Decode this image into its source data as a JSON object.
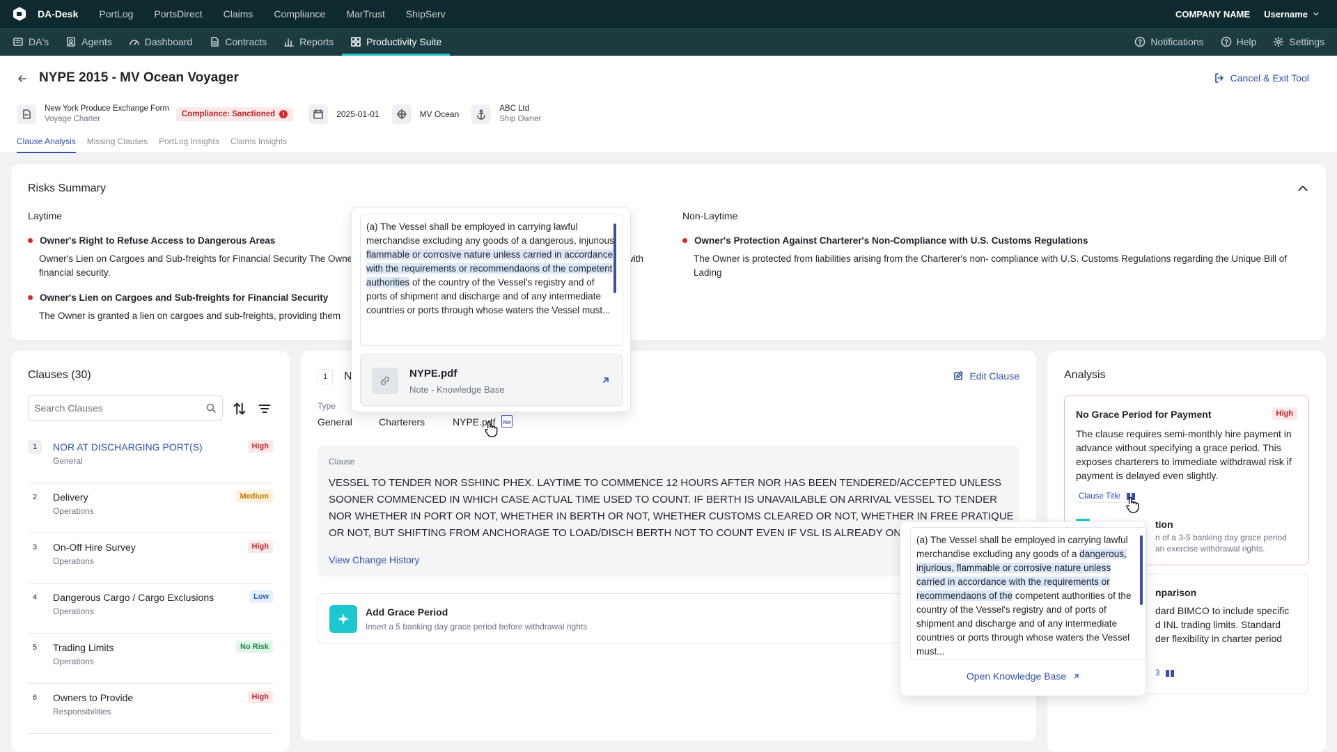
{
  "topnav": {
    "brand": "DA-Desk",
    "links": [
      "PortLog",
      "PortsDirect",
      "Claims",
      "Compliance",
      "MarTrust",
      "ShipServ"
    ],
    "company": "COMPANY NAME",
    "username": "Username"
  },
  "subnav": {
    "items": [
      "DA's",
      "Agents",
      "Dashboard",
      "Contracts",
      "Reports",
      "Productivity Suite"
    ],
    "right": [
      "Notifications",
      "Help",
      "Settings"
    ]
  },
  "header": {
    "title": "NYPE 2015 - MV Ocean Voyager",
    "cancel": "Cancel & Exit Tool",
    "form_name": "New York Produce Exchange Form",
    "form_type": "Voyage Charter",
    "compliance": "Compliance: Sanctioned",
    "compliance_count": "!",
    "date": "2025-01-01",
    "vessel": "MV Ocean",
    "owner_name": "ABC Ltd",
    "owner_role": "Ship Owner"
  },
  "tabs": [
    "Clause Analysis",
    "Missing Clauses",
    "PortLog Insights",
    "Claims Insights"
  ],
  "risks": {
    "title": "Risks Summary",
    "laytime_label": "Laytime",
    "nonlaytime_label": "Non-Laytime",
    "laytime": [
      {
        "title": "Owner's Right to Refuse Access to Dangerous Areas",
        "desc": "Owner's Lien on Cargoes and Sub-freights for Financial Security The Owner",
        "desc_tail": "with",
        "desc2": "financial security."
      },
      {
        "title": "Owner's Lien on Cargoes and Sub-freights for Financial Security",
        "desc": "The Owner is granted a lien on cargoes and sub-freights, providing them"
      }
    ],
    "nonlaytime": [
      {
        "title": "Owner's Protection Against Charterer's Non-Compliance with U.S. Customs Regulations",
        "desc": "The Owner is protected from liabilities arising from the Charterer's non- compliance with U.S. Customs Regulations regarding the Unique Bill of",
        "desc2": "Lading"
      }
    ]
  },
  "clauses": {
    "title": "Clauses (30)",
    "search_placeholder": "Search Clauses",
    "items": [
      {
        "num": "1",
        "title": "NOR AT DISCHARGING PORT(S)",
        "cat": "General",
        "level": "High"
      },
      {
        "num": "2",
        "title": "Delivery",
        "cat": "Operations",
        "level": "Medium"
      },
      {
        "num": "3",
        "title": "On-Off Hire Survey",
        "cat": "Operations",
        "level": "High"
      },
      {
        "num": "4",
        "title": "Dangerous Cargo / Cargo Exclusions",
        "cat": "Operations",
        "level": "Low"
      },
      {
        "num": "5",
        "title": "Trading Limits",
        "cat": "Operations",
        "level": "No Risk"
      },
      {
        "num": "6",
        "title": "Owners to Provide",
        "cat": "Responsibilities",
        "level": "High"
      }
    ]
  },
  "detail": {
    "num": "1",
    "title_partial": "N",
    "edit": "Edit Clause",
    "type_label": "Type",
    "type_value": "General",
    "party": "Charterers",
    "file": "NYPE.pdf",
    "file_icon_label": "PDF",
    "clause_label": "Clause",
    "clause_lines": [
      "VESSEL TO TENDER NOR SSHINC PHEX. LAYTIME TO COMMENCE 12 HOURS AFTER NOR HAS BEEN TENDERED/ACCEPTED UNLESS",
      "SOONER COMMENCED IN WHICH CASE ACTUAL TIME USED TO COUNT. IF BERTH IS UNAVAILABLE ON ARRIVAL VESSEL TO TENDER",
      "NOR WHETHER IN PORT OR NOT, WHETHER IN BERTH OR NOT, WHETHER CUSTOMS CLEARED OR NOT, WHETHER IN FREE PRATIQUE",
      "OR NOT, BUT SHIFTING FROM ANCHORAGE TO LOAD/DISCH BERTH NOT TO COUNT EVEN IF VSL IS ALREADY ON D"
    ],
    "history": "View Change History",
    "suggestion_title": "Add Grace Period",
    "suggestion_desc": "Insert a 5 banking day grace period before withdrawal rights"
  },
  "popover1": {
    "pre": "(a) The Vessel shall be employed in carrying lawful merchandise excluding any goods of a dangerous, injurious, ",
    "hl": "flammable or corrosive nature unless carried in accordance with the requirements or recommendaons of the competent authorities",
    "post": " of the country of the Vessel's registry and of ports of shipment and discharge and of any intermediate countries or ports through whose waters the Vessel must...",
    "file": "NYPE.pdf",
    "file_sub": "Note - Knowledge Base"
  },
  "analysis": {
    "title": "Analysis",
    "card1_title": "No Grace Period for Payment",
    "card1_level": "High",
    "card1_desc": "The clause requires semi-monthly hire payment in advance without specifying a grace period. This exposes charterers to immediate withdrawal risk if payment is delayed even slightly.",
    "card1_ref": "Clause Title",
    "card2_title_tail": "tion",
    "card2_desc1": "n of a 3-5 banking day grace period",
    "card2_desc2": "an exercise withdrawal rights.",
    "card3_title_tail": "nparison",
    "card3_desc1": "dard BIMCO to include specific",
    "card3_desc2": "d INL trading limits. Standard",
    "card3_desc3": "der flexibility in charter period",
    "card3_ref_tail": "3"
  },
  "popover2": {
    "pre": "(a) The Vessel shall be employed in carrying lawful merchandise excluding any goods of a ",
    "hl": "dangerous, injurious, flammable or corrosive nature unless carried in accordance with the requirements or recommendaons of the",
    "post": " competent authorities of the country of the Vessel's registry and of ports of shipment and discharge and of any intermediate countries or ports through whose waters the Vessel must...",
    "link": "Open Knowledge Base"
  },
  "colors": {
    "topnav": "#0e2a2e",
    "subnav": "#1d3b3f",
    "accent": "#27c3c9",
    "link": "#2f4fa8",
    "danger": "#c0242d"
  }
}
